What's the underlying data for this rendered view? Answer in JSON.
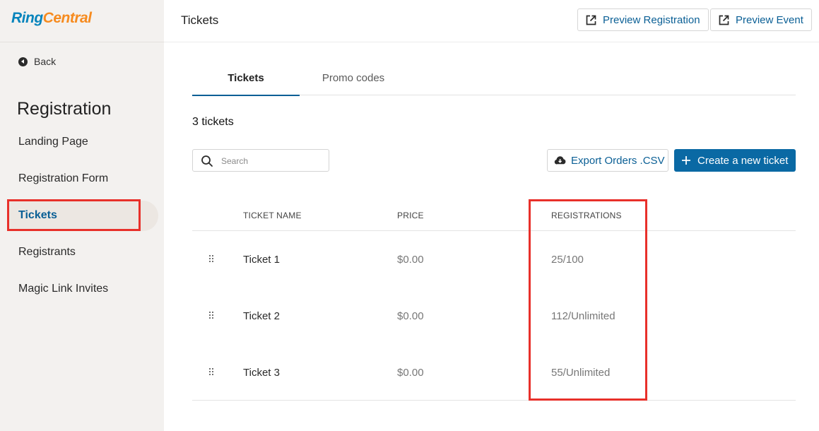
{
  "brand": {
    "logo_part1": "Ring",
    "logo_part2": "Central"
  },
  "sidebar": {
    "back_label": "Back",
    "section_title": "Registration",
    "items": [
      {
        "label": "Landing Page",
        "active": false
      },
      {
        "label": "Registration Form",
        "active": false
      },
      {
        "label": "Tickets",
        "active": true
      },
      {
        "label": "Registrants",
        "active": false
      },
      {
        "label": "Magic Link Invites",
        "active": false
      }
    ]
  },
  "header": {
    "title": "Tickets",
    "preview_registration_label": "Preview Registration",
    "preview_event_label": "Preview Event"
  },
  "tabs": [
    {
      "label": "Tickets",
      "active": true
    },
    {
      "label": "Promo codes",
      "active": false
    }
  ],
  "tickets": {
    "count_label": "3 tickets",
    "search_placeholder": "Search",
    "export_label": "Export Orders .CSV",
    "create_label": "Create a new ticket",
    "columns": {
      "name": "TICKET NAME",
      "price": "PRICE",
      "registrations": "REGISTRATIONS"
    },
    "rows": [
      {
        "name": "Ticket 1",
        "price": "$0.00",
        "registrations": "25/100"
      },
      {
        "name": "Ticket 2",
        "price": "$0.00",
        "registrations": "112/Unlimited"
      },
      {
        "name": "Ticket 3",
        "price": "$0.00",
        "registrations": "55/Unlimited"
      }
    ]
  },
  "colors": {
    "accent": "#0a69a4",
    "link": "#0a5f95",
    "highlight_box": "#e8302a",
    "sidebar_bg": "#f3f1ef"
  }
}
